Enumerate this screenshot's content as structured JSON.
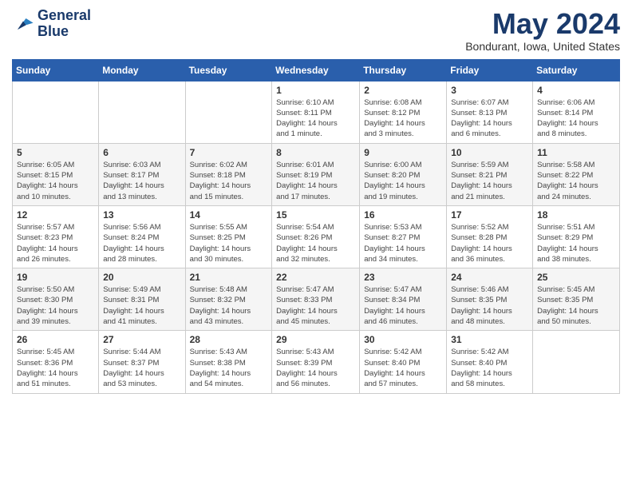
{
  "logo": {
    "line1": "General",
    "line2": "Blue"
  },
  "title": "May 2024",
  "subtitle": "Bondurant, Iowa, United States",
  "weekdays": [
    "Sunday",
    "Monday",
    "Tuesday",
    "Wednesday",
    "Thursday",
    "Friday",
    "Saturday"
  ],
  "weeks": [
    [
      {
        "day": "",
        "info": ""
      },
      {
        "day": "",
        "info": ""
      },
      {
        "day": "",
        "info": ""
      },
      {
        "day": "1",
        "info": "Sunrise: 6:10 AM\nSunset: 8:11 PM\nDaylight: 14 hours\nand 1 minute."
      },
      {
        "day": "2",
        "info": "Sunrise: 6:08 AM\nSunset: 8:12 PM\nDaylight: 14 hours\nand 3 minutes."
      },
      {
        "day": "3",
        "info": "Sunrise: 6:07 AM\nSunset: 8:13 PM\nDaylight: 14 hours\nand 6 minutes."
      },
      {
        "day": "4",
        "info": "Sunrise: 6:06 AM\nSunset: 8:14 PM\nDaylight: 14 hours\nand 8 minutes."
      }
    ],
    [
      {
        "day": "5",
        "info": "Sunrise: 6:05 AM\nSunset: 8:15 PM\nDaylight: 14 hours\nand 10 minutes."
      },
      {
        "day": "6",
        "info": "Sunrise: 6:03 AM\nSunset: 8:17 PM\nDaylight: 14 hours\nand 13 minutes."
      },
      {
        "day": "7",
        "info": "Sunrise: 6:02 AM\nSunset: 8:18 PM\nDaylight: 14 hours\nand 15 minutes."
      },
      {
        "day": "8",
        "info": "Sunrise: 6:01 AM\nSunset: 8:19 PM\nDaylight: 14 hours\nand 17 minutes."
      },
      {
        "day": "9",
        "info": "Sunrise: 6:00 AM\nSunset: 8:20 PM\nDaylight: 14 hours\nand 19 minutes."
      },
      {
        "day": "10",
        "info": "Sunrise: 5:59 AM\nSunset: 8:21 PM\nDaylight: 14 hours\nand 21 minutes."
      },
      {
        "day": "11",
        "info": "Sunrise: 5:58 AM\nSunset: 8:22 PM\nDaylight: 14 hours\nand 24 minutes."
      }
    ],
    [
      {
        "day": "12",
        "info": "Sunrise: 5:57 AM\nSunset: 8:23 PM\nDaylight: 14 hours\nand 26 minutes."
      },
      {
        "day": "13",
        "info": "Sunrise: 5:56 AM\nSunset: 8:24 PM\nDaylight: 14 hours\nand 28 minutes."
      },
      {
        "day": "14",
        "info": "Sunrise: 5:55 AM\nSunset: 8:25 PM\nDaylight: 14 hours\nand 30 minutes."
      },
      {
        "day": "15",
        "info": "Sunrise: 5:54 AM\nSunset: 8:26 PM\nDaylight: 14 hours\nand 32 minutes."
      },
      {
        "day": "16",
        "info": "Sunrise: 5:53 AM\nSunset: 8:27 PM\nDaylight: 14 hours\nand 34 minutes."
      },
      {
        "day": "17",
        "info": "Sunrise: 5:52 AM\nSunset: 8:28 PM\nDaylight: 14 hours\nand 36 minutes."
      },
      {
        "day": "18",
        "info": "Sunrise: 5:51 AM\nSunset: 8:29 PM\nDaylight: 14 hours\nand 38 minutes."
      }
    ],
    [
      {
        "day": "19",
        "info": "Sunrise: 5:50 AM\nSunset: 8:30 PM\nDaylight: 14 hours\nand 39 minutes."
      },
      {
        "day": "20",
        "info": "Sunrise: 5:49 AM\nSunset: 8:31 PM\nDaylight: 14 hours\nand 41 minutes."
      },
      {
        "day": "21",
        "info": "Sunrise: 5:48 AM\nSunset: 8:32 PM\nDaylight: 14 hours\nand 43 minutes."
      },
      {
        "day": "22",
        "info": "Sunrise: 5:47 AM\nSunset: 8:33 PM\nDaylight: 14 hours\nand 45 minutes."
      },
      {
        "day": "23",
        "info": "Sunrise: 5:47 AM\nSunset: 8:34 PM\nDaylight: 14 hours\nand 46 minutes."
      },
      {
        "day": "24",
        "info": "Sunrise: 5:46 AM\nSunset: 8:35 PM\nDaylight: 14 hours\nand 48 minutes."
      },
      {
        "day": "25",
        "info": "Sunrise: 5:45 AM\nSunset: 8:35 PM\nDaylight: 14 hours\nand 50 minutes."
      }
    ],
    [
      {
        "day": "26",
        "info": "Sunrise: 5:45 AM\nSunset: 8:36 PM\nDaylight: 14 hours\nand 51 minutes."
      },
      {
        "day": "27",
        "info": "Sunrise: 5:44 AM\nSunset: 8:37 PM\nDaylight: 14 hours\nand 53 minutes."
      },
      {
        "day": "28",
        "info": "Sunrise: 5:43 AM\nSunset: 8:38 PM\nDaylight: 14 hours\nand 54 minutes."
      },
      {
        "day": "29",
        "info": "Sunrise: 5:43 AM\nSunset: 8:39 PM\nDaylight: 14 hours\nand 56 minutes."
      },
      {
        "day": "30",
        "info": "Sunrise: 5:42 AM\nSunset: 8:40 PM\nDaylight: 14 hours\nand 57 minutes."
      },
      {
        "day": "31",
        "info": "Sunrise: 5:42 AM\nSunset: 8:40 PM\nDaylight: 14 hours\nand 58 minutes."
      },
      {
        "day": "",
        "info": ""
      }
    ]
  ]
}
